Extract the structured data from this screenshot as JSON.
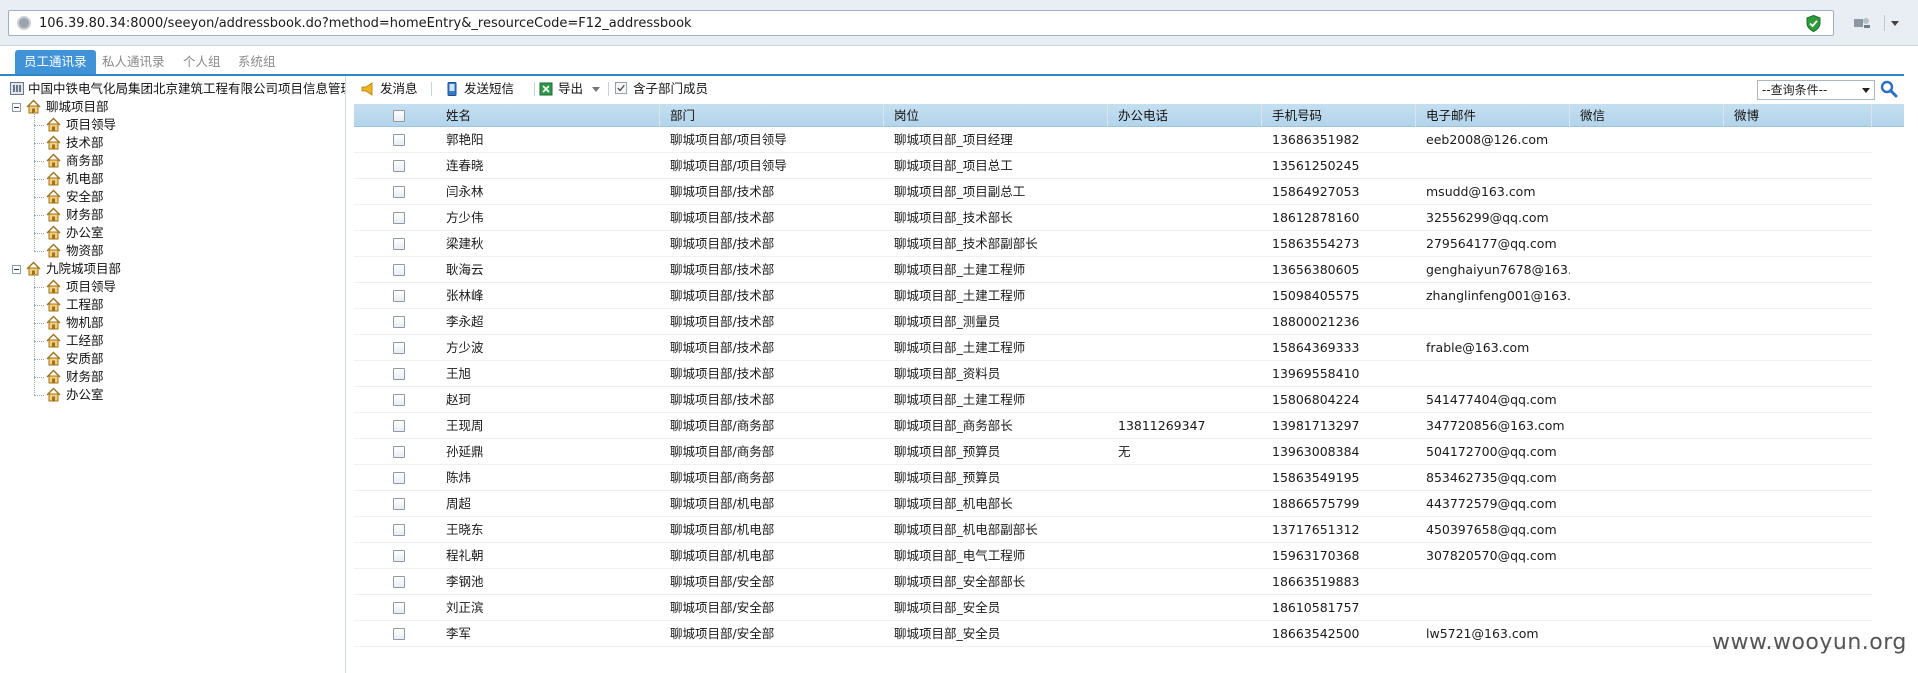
{
  "browser": {
    "url": "106.39.80.34:8000/seeyon/addressbook.do?method=homeEntry&_resourceCode=F12_addressbook"
  },
  "tabs": [
    {
      "label": "员工通讯录",
      "active": true
    },
    {
      "label": "私人通讯录",
      "active": false
    },
    {
      "label": "个人组",
      "active": false
    },
    {
      "label": "系统组",
      "active": false
    }
  ],
  "tree": {
    "root": "中国中铁电气化局集团北京建筑工程有限公司项目信息管理系",
    "groups": [
      {
        "label": "聊城项目部",
        "children": [
          "项目领导",
          "技术部",
          "商务部",
          "机电部",
          "安全部",
          "财务部",
          "办公室",
          "物资部"
        ]
      },
      {
        "label": "九院城项目部",
        "children": [
          "项目领导",
          "工程部",
          "物机部",
          "工经部",
          "安质部",
          "财务部",
          "办公室"
        ]
      }
    ]
  },
  "toolbar": {
    "send_message": "发消息",
    "send_sms": "发送短信",
    "export": "导出",
    "include_sub": "含子部门成员",
    "query_placeholder": "--查询条件--"
  },
  "table": {
    "columns": [
      "姓名",
      "部门",
      "岗位",
      "办公电话",
      "手机号码",
      "电子邮件",
      "微信",
      "微博"
    ],
    "rows": [
      [
        "郭艳阳",
        "聊城项目部/项目领导",
        "聊城项目部_项目经理",
        "",
        "13686351982",
        "eeb2008@126.com",
        "",
        ""
      ],
      [
        "连春晓",
        "聊城项目部/项目领导",
        "聊城项目部_项目总工",
        "",
        "13561250245",
        "",
        "",
        ""
      ],
      [
        "闫永林",
        "聊城项目部/技术部",
        "聊城项目部_项目副总工",
        "",
        "15864927053",
        "msudd@163.com",
        "",
        ""
      ],
      [
        "方少伟",
        "聊城项目部/技术部",
        "聊城项目部_技术部长",
        "",
        "18612878160",
        "32556299@qq.com",
        "",
        ""
      ],
      [
        "梁建秋",
        "聊城项目部/技术部",
        "聊城项目部_技术部副部长",
        "",
        "15863554273",
        "279564177@qq.com",
        "",
        ""
      ],
      [
        "耿海云",
        "聊城项目部/技术部",
        "聊城项目部_土建工程师",
        "",
        "13656380605",
        "genghaiyun7678@163....",
        "",
        ""
      ],
      [
        "张林峰",
        "聊城项目部/技术部",
        "聊城项目部_土建工程师",
        "",
        "15098405575",
        "zhanglinfeng001@163....",
        "",
        ""
      ],
      [
        "李永超",
        "聊城项目部/技术部",
        "聊城项目部_测量员",
        "",
        "18800021236",
        "",
        "",
        ""
      ],
      [
        "方少波",
        "聊城项目部/技术部",
        "聊城项目部_土建工程师",
        "",
        "15864369333",
        "frable@163.com",
        "",
        ""
      ],
      [
        "王旭",
        "聊城项目部/技术部",
        "聊城项目部_资料员",
        "",
        "13969558410",
        "",
        "",
        ""
      ],
      [
        "赵珂",
        "聊城项目部/技术部",
        "聊城项目部_土建工程师",
        "",
        "15806804224",
        "541477404@qq.com",
        "",
        ""
      ],
      [
        "王现周",
        "聊城项目部/商务部",
        "聊城项目部_商务部长",
        "13811269347",
        "13981713297",
        "347720856@163.com",
        "",
        ""
      ],
      [
        "孙延鼎",
        "聊城项目部/商务部",
        "聊城项目部_预算员",
        "无",
        "13963008384",
        "504172700@qq.com",
        "",
        ""
      ],
      [
        "陈炜",
        "聊城项目部/商务部",
        "聊城项目部_预算员",
        "",
        "15863549195",
        "853462735@qq.com",
        "",
        ""
      ],
      [
        "周超",
        "聊城项目部/机电部",
        "聊城项目部_机电部长",
        "",
        "18866575799",
        "443772579@qq.com",
        "",
        ""
      ],
      [
        "王晓东",
        "聊城项目部/机电部",
        "聊城项目部_机电部副部长",
        "",
        "13717651312",
        "450397658@qq.com",
        "",
        ""
      ],
      [
        "程礼朝",
        "聊城项目部/机电部",
        "聊城项目部_电气工程师",
        "",
        "15963170368",
        "307820570@qq.com",
        "",
        ""
      ],
      [
        "李钢池",
        "聊城项目部/安全部",
        "聊城项目部_安全部部长",
        "",
        "18663519883",
        "",
        "",
        ""
      ],
      [
        "刘正滨",
        "聊城项目部/安全部",
        "聊城项目部_安全员",
        "",
        "18610581757",
        "",
        "",
        ""
      ],
      [
        "李军",
        "聊城项目部/安全部",
        "聊城项目部_安全员",
        "",
        "18663542500",
        "lw5721@163.com",
        "",
        ""
      ]
    ]
  },
  "watermark": "www.wooyun.org"
}
